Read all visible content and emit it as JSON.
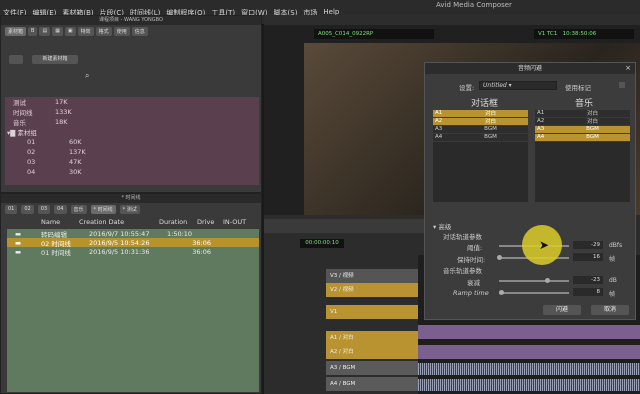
{
  "app": {
    "title": "Avid Media Composer"
  },
  "menus": [
    "文件(F)",
    "编辑(E)",
    "素材箱(B)",
    "片段(C)",
    "时间线(L)",
    "编制程序(O)",
    "工具(T)",
    "窗口(W)",
    "脚本(S)",
    "市场",
    "Help"
  ],
  "project": {
    "title": "课程项目 - WANG YONGBO",
    "tabs": [
      "素材箱",
      "",
      "",
      "",
      "",
      "特效",
      "格式",
      "使用",
      "信息"
    ],
    "new_bin": "新建素材箱",
    "items": [
      {
        "name": "测试",
        "size": "17K"
      },
      {
        "name": "时间线",
        "size": "133K"
      },
      {
        "name": "音乐",
        "size": "18K"
      },
      {
        "name": "素材组",
        "size": ""
      },
      {
        "name": "01",
        "size": "60K"
      },
      {
        "name": "02",
        "size": "137K"
      },
      {
        "name": "03",
        "size": "47K"
      },
      {
        "name": "04",
        "size": "30K"
      }
    ]
  },
  "timeline_bin": {
    "title": "* 时间线",
    "tabs": [
      "01",
      "02",
      "03",
      "04",
      "音乐",
      "* 时间线",
      "* 测试"
    ],
    "columns": [
      "Name",
      "Creation Date",
      "Duration",
      "Drive",
      "IN-OUT"
    ],
    "rows": [
      {
        "name": "转码编辑",
        "date": "2016/9/7 10:55:47",
        "duration": "1:50:10"
      },
      {
        "name": "02 时间线",
        "date": "2016/9/5 10:54:26",
        "duration": "36:06"
      },
      {
        "name": "01 时间线",
        "date": "2016/9/5 10:31:36",
        "duration": "36:06"
      }
    ]
  },
  "composer": {
    "clip_name": "A005_C014_0922RP",
    "track_label": "V1 TC1",
    "timecode": "10:38:50:06"
  },
  "dialog": {
    "title": "音频闪避",
    "settings_label": "设置:",
    "settings_value": "Untitled",
    "use_marker": "使用标记",
    "dialogue_header": "对话框",
    "music_header": "音乐",
    "dialogue_map": [
      {
        "track": "A1",
        "value": "对白",
        "selected": true
      },
      {
        "track": "A2",
        "value": "对白",
        "selected": true
      },
      {
        "track": "A3",
        "value": "BGM",
        "selected": false
      },
      {
        "track": "A4",
        "value": "BGM",
        "selected": false
      }
    ],
    "music_map": [
      {
        "track": "A1",
        "value": "对白",
        "selected": false
      },
      {
        "track": "A2",
        "value": "对白",
        "selected": false
      },
      {
        "track": "A3",
        "value": "BGM",
        "selected": true
      },
      {
        "track": "A4",
        "value": "BGM",
        "selected": true
      }
    ],
    "advanced": "高级",
    "dialogue_params": "对话轨道参数",
    "threshold_label": "阈值:",
    "threshold_value": "-29",
    "threshold_unit": "dBfs",
    "hold_label": "保持时间:",
    "hold_value": "16",
    "hold_unit": "帧",
    "music_params": "音乐轨道参数",
    "atten_label": "衰减",
    "atten_value": "-23",
    "atten_unit": "dB",
    "ramp_label": "Ramp time",
    "ramp_value": "8",
    "ramp_unit": "帧",
    "duck_button": "闪避",
    "cancel_button": "取消"
  },
  "timeline": {
    "timecode": "00:00:00:10",
    "tracks": [
      "V3 / 视频",
      "V2 / 视频",
      "V1",
      "A1 / 对白",
      "A2 / 对白",
      "A3 / BGM",
      "A4 / BGM"
    ]
  }
}
